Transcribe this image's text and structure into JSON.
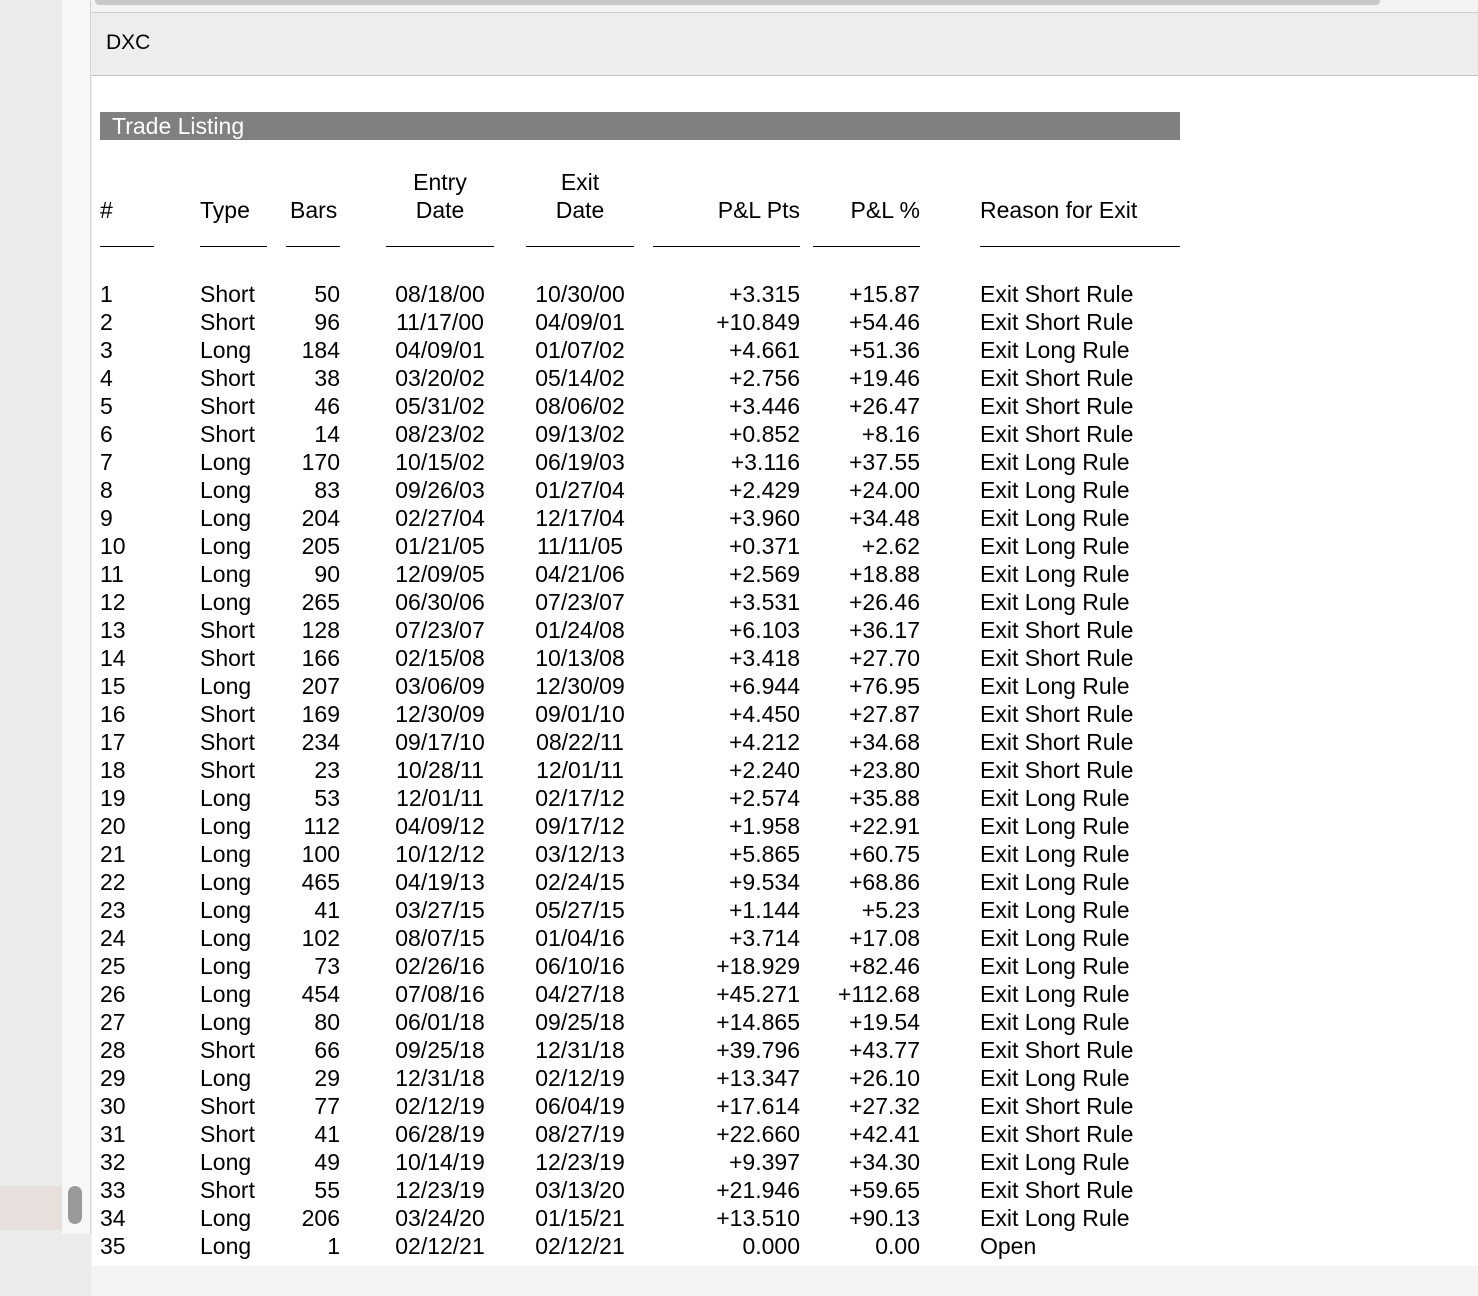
{
  "header": {
    "title": "DXC"
  },
  "section": {
    "title": "Trade Listing"
  },
  "columns": {
    "num": "#",
    "type": "Type",
    "bars": "Bars",
    "entry_line1": "Entry",
    "entry_line2": "Date",
    "exit_line1": "Exit",
    "exit_line2": "Date",
    "pl_pts": "P&L Pts",
    "pl_pct": "P&L %",
    "reason": "Reason for Exit"
  },
  "trades": [
    {
      "num": "1",
      "type": "Short",
      "bars": "50",
      "entry": "08/18/00",
      "exit": "10/30/00",
      "pts": "+3.315",
      "pct": "+15.87",
      "reason": "Exit Short Rule"
    },
    {
      "num": "2",
      "type": "Short",
      "bars": "96",
      "entry": "11/17/00",
      "exit": "04/09/01",
      "pts": "+10.849",
      "pct": "+54.46",
      "reason": "Exit Short Rule"
    },
    {
      "num": "3",
      "type": "Long",
      "bars": "184",
      "entry": "04/09/01",
      "exit": "01/07/02",
      "pts": "+4.661",
      "pct": "+51.36",
      "reason": "Exit Long Rule"
    },
    {
      "num": "4",
      "type": "Short",
      "bars": "38",
      "entry": "03/20/02",
      "exit": "05/14/02",
      "pts": "+2.756",
      "pct": "+19.46",
      "reason": "Exit Short Rule"
    },
    {
      "num": "5",
      "type": "Short",
      "bars": "46",
      "entry": "05/31/02",
      "exit": "08/06/02",
      "pts": "+3.446",
      "pct": "+26.47",
      "reason": "Exit Short Rule"
    },
    {
      "num": "6",
      "type": "Short",
      "bars": "14",
      "entry": "08/23/02",
      "exit": "09/13/02",
      "pts": "+0.852",
      "pct": "+8.16",
      "reason": "Exit Short Rule"
    },
    {
      "num": "7",
      "type": "Long",
      "bars": "170",
      "entry": "10/15/02",
      "exit": "06/19/03",
      "pts": "+3.116",
      "pct": "+37.55",
      "reason": "Exit Long Rule"
    },
    {
      "num": "8",
      "type": "Long",
      "bars": "83",
      "entry": "09/26/03",
      "exit": "01/27/04",
      "pts": "+2.429",
      "pct": "+24.00",
      "reason": "Exit Long Rule"
    },
    {
      "num": "9",
      "type": "Long",
      "bars": "204",
      "entry": "02/27/04",
      "exit": "12/17/04",
      "pts": "+3.960",
      "pct": "+34.48",
      "reason": "Exit Long Rule"
    },
    {
      "num": "10",
      "type": "Long",
      "bars": "205",
      "entry": "01/21/05",
      "exit": "11/11/05",
      "pts": "+0.371",
      "pct": "+2.62",
      "reason": "Exit Long Rule"
    },
    {
      "num": "11",
      "type": "Long",
      "bars": "90",
      "entry": "12/09/05",
      "exit": "04/21/06",
      "pts": "+2.569",
      "pct": "+18.88",
      "reason": "Exit Long Rule"
    },
    {
      "num": "12",
      "type": "Long",
      "bars": "265",
      "entry": "06/30/06",
      "exit": "07/23/07",
      "pts": "+3.531",
      "pct": "+26.46",
      "reason": "Exit Long Rule"
    },
    {
      "num": "13",
      "type": "Short",
      "bars": "128",
      "entry": "07/23/07",
      "exit": "01/24/08",
      "pts": "+6.103",
      "pct": "+36.17",
      "reason": "Exit Short Rule"
    },
    {
      "num": "14",
      "type": "Short",
      "bars": "166",
      "entry": "02/15/08",
      "exit": "10/13/08",
      "pts": "+3.418",
      "pct": "+27.70",
      "reason": "Exit Short Rule"
    },
    {
      "num": "15",
      "type": "Long",
      "bars": "207",
      "entry": "03/06/09",
      "exit": "12/30/09",
      "pts": "+6.944",
      "pct": "+76.95",
      "reason": "Exit Long Rule"
    },
    {
      "num": "16",
      "type": "Short",
      "bars": "169",
      "entry": "12/30/09",
      "exit": "09/01/10",
      "pts": "+4.450",
      "pct": "+27.87",
      "reason": "Exit Short Rule"
    },
    {
      "num": "17",
      "type": "Short",
      "bars": "234",
      "entry": "09/17/10",
      "exit": "08/22/11",
      "pts": "+4.212",
      "pct": "+34.68",
      "reason": "Exit Short Rule"
    },
    {
      "num": "18",
      "type": "Short",
      "bars": "23",
      "entry": "10/28/11",
      "exit": "12/01/11",
      "pts": "+2.240",
      "pct": "+23.80",
      "reason": "Exit Short Rule"
    },
    {
      "num": "19",
      "type": "Long",
      "bars": "53",
      "entry": "12/01/11",
      "exit": "02/17/12",
      "pts": "+2.574",
      "pct": "+35.88",
      "reason": "Exit Long Rule"
    },
    {
      "num": "20",
      "type": "Long",
      "bars": "112",
      "entry": "04/09/12",
      "exit": "09/17/12",
      "pts": "+1.958",
      "pct": "+22.91",
      "reason": "Exit Long Rule"
    },
    {
      "num": "21",
      "type": "Long",
      "bars": "100",
      "entry": "10/12/12",
      "exit": "03/12/13",
      "pts": "+5.865",
      "pct": "+60.75",
      "reason": "Exit Long Rule"
    },
    {
      "num": "22",
      "type": "Long",
      "bars": "465",
      "entry": "04/19/13",
      "exit": "02/24/15",
      "pts": "+9.534",
      "pct": "+68.86",
      "reason": "Exit Long Rule"
    },
    {
      "num": "23",
      "type": "Long",
      "bars": "41",
      "entry": "03/27/15",
      "exit": "05/27/15",
      "pts": "+1.144",
      "pct": "+5.23",
      "reason": "Exit Long Rule"
    },
    {
      "num": "24",
      "type": "Long",
      "bars": "102",
      "entry": "08/07/15",
      "exit": "01/04/16",
      "pts": "+3.714",
      "pct": "+17.08",
      "reason": "Exit Long Rule"
    },
    {
      "num": "25",
      "type": "Long",
      "bars": "73",
      "entry": "02/26/16",
      "exit": "06/10/16",
      "pts": "+18.929",
      "pct": "+82.46",
      "reason": "Exit Long Rule"
    },
    {
      "num": "26",
      "type": "Long",
      "bars": "454",
      "entry": "07/08/16",
      "exit": "04/27/18",
      "pts": "+45.271",
      "pct": "+112.68",
      "reason": "Exit Long Rule"
    },
    {
      "num": "27",
      "type": "Long",
      "bars": "80",
      "entry": "06/01/18",
      "exit": "09/25/18",
      "pts": "+14.865",
      "pct": "+19.54",
      "reason": "Exit Long Rule"
    },
    {
      "num": "28",
      "type": "Short",
      "bars": "66",
      "entry": "09/25/18",
      "exit": "12/31/18",
      "pts": "+39.796",
      "pct": "+43.77",
      "reason": "Exit Short Rule"
    },
    {
      "num": "29",
      "type": "Long",
      "bars": "29",
      "entry": "12/31/18",
      "exit": "02/12/19",
      "pts": "+13.347",
      "pct": "+26.10",
      "reason": "Exit Long Rule"
    },
    {
      "num": "30",
      "type": "Short",
      "bars": "77",
      "entry": "02/12/19",
      "exit": "06/04/19",
      "pts": "+17.614",
      "pct": "+27.32",
      "reason": "Exit Short Rule"
    },
    {
      "num": "31",
      "type": "Short",
      "bars": "41",
      "entry": "06/28/19",
      "exit": "08/27/19",
      "pts": "+22.660",
      "pct": "+42.41",
      "reason": "Exit Short Rule"
    },
    {
      "num": "32",
      "type": "Long",
      "bars": "49",
      "entry": "10/14/19",
      "exit": "12/23/19",
      "pts": "+9.397",
      "pct": "+34.30",
      "reason": "Exit Long Rule"
    },
    {
      "num": "33",
      "type": "Short",
      "bars": "55",
      "entry": "12/23/19",
      "exit": "03/13/20",
      "pts": "+21.946",
      "pct": "+59.65",
      "reason": "Exit Short Rule"
    },
    {
      "num": "34",
      "type": "Long",
      "bars": "206",
      "entry": "03/24/20",
      "exit": "01/15/21",
      "pts": "+13.510",
      "pct": "+90.13",
      "reason": "Exit Long Rule"
    },
    {
      "num": "35",
      "type": "Long",
      "bars": "1",
      "entry": "02/12/21",
      "exit": "02/12/21",
      "pts": "0.000",
      "pct": "0.00",
      "reason": "Open"
    }
  ]
}
